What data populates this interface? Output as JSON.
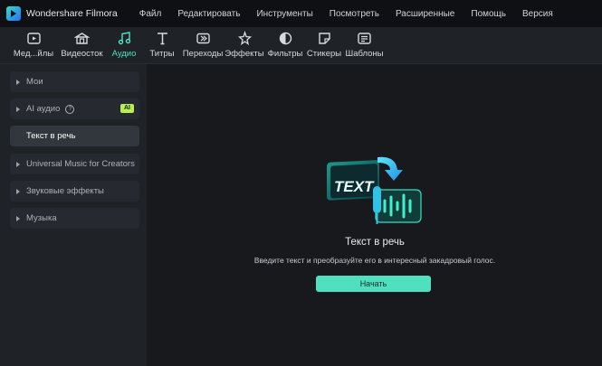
{
  "app": {
    "name": "Wondershare Filmora"
  },
  "menu": [
    "Файл",
    "Редактировать",
    "Инструменты",
    "Посмотреть",
    "Расширенные",
    "Помощь",
    "Версия"
  ],
  "toolbar": {
    "items": [
      {
        "label": "Мед...йлы",
        "icon": "media-icon"
      },
      {
        "label": "Видеосток",
        "icon": "stock-video-icon"
      },
      {
        "label": "Аудио",
        "icon": "music-note-icon",
        "active": true
      },
      {
        "label": "Титры",
        "icon": "text-icon"
      },
      {
        "label": "Переходы",
        "icon": "transition-icon"
      },
      {
        "label": "Эффекты",
        "icon": "effects-icon"
      },
      {
        "label": "Фильтры",
        "icon": "filter-icon"
      },
      {
        "label": "Стикеры",
        "icon": "sticker-icon"
      },
      {
        "label": "Шаблоны",
        "icon": "template-icon"
      }
    ]
  },
  "sidebar": {
    "items": [
      {
        "label": "Мои"
      },
      {
        "label": "AI аудио",
        "badge": "AI"
      },
      {
        "label": "Текст в речь",
        "selected": true
      },
      {
        "label": "Universal Music for Creators"
      },
      {
        "label": "Звуковые эффекты"
      },
      {
        "label": "Музыка"
      }
    ]
  },
  "main": {
    "illustration_text": "TEXT",
    "title": "Текст в речь",
    "description": "Введите текст и преобразуйте его в интересный закадровый голос.",
    "button": "Начать"
  },
  "colors": {
    "accent": "#4ee0c2",
    "badge": "#b6ef4e",
    "background": "#17191d",
    "panel": "#1f2227"
  }
}
